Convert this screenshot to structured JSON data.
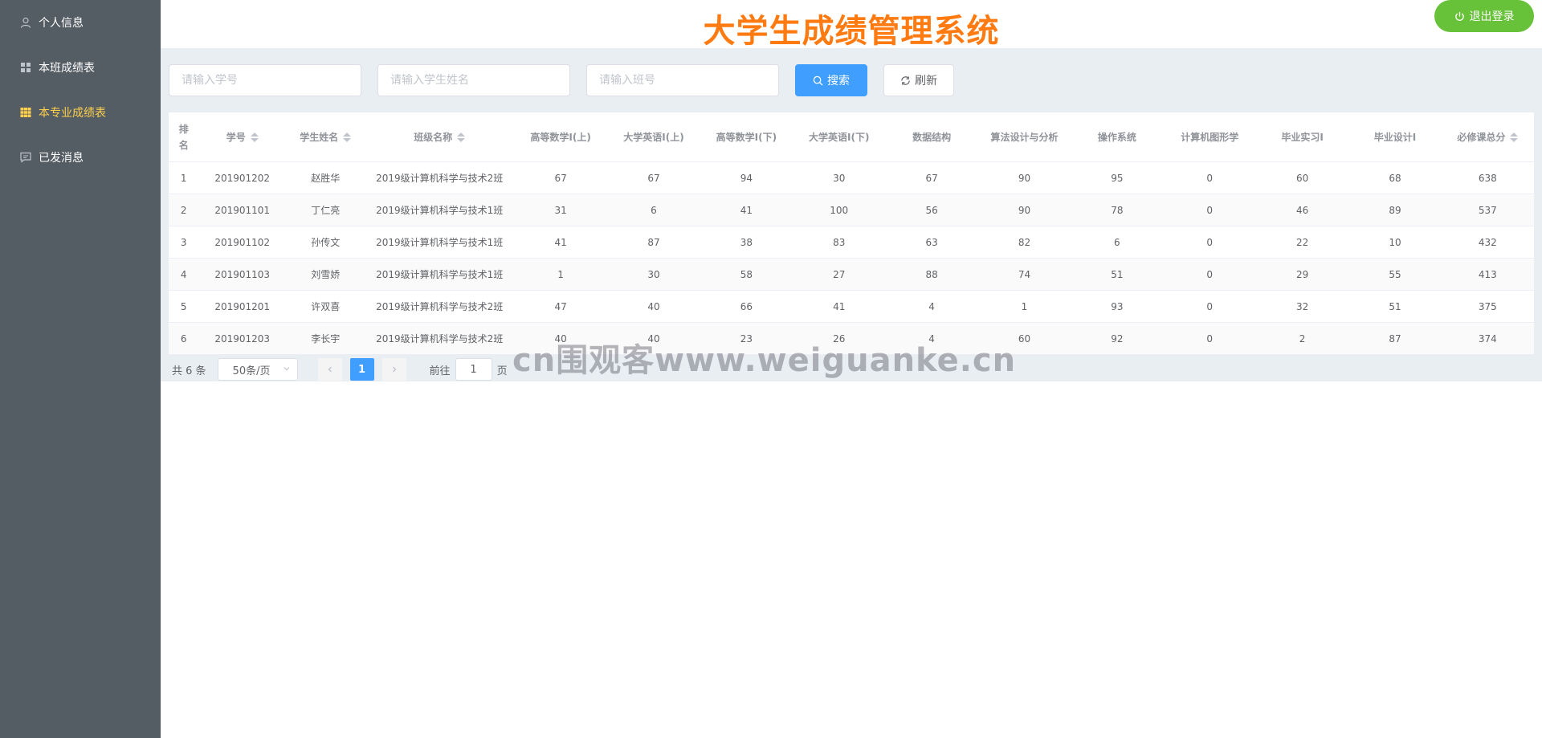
{
  "sidebar": {
    "items": [
      {
        "label": "个人信息",
        "icon": "user-icon"
      },
      {
        "label": "本班成绩表",
        "icon": "grid-icon"
      },
      {
        "label": "本专业成绩表",
        "icon": "table-icon"
      },
      {
        "label": "已发消息",
        "icon": "message-icon"
      }
    ],
    "active_index": 2,
    "colors": {
      "bg": "#545c64",
      "active": "#ffd04b"
    }
  },
  "header": {
    "title": "大学生成绩管理系统",
    "logout_label": "退出登录"
  },
  "search": {
    "student_id_placeholder": "请输入学号",
    "student_name_placeholder": "请输入学生姓名",
    "class_placeholder": "请输入班号",
    "search_label": "搜索",
    "refresh_label": "刷新"
  },
  "table": {
    "columns": [
      "排名",
      "学号",
      "学生姓名",
      "班级名称",
      "高等数学I(上)",
      "大学英语I(上)",
      "高等数学I(下)",
      "大学英语I(下)",
      "数据结构",
      "算法设计与分析",
      "操作系统",
      "计算机图形学",
      "毕业实习I",
      "毕业设计I",
      "必修课总分"
    ],
    "rows": [
      [
        "1",
        "201901202",
        "赵胜华",
        "2019级计算机科学与技术2班",
        "67",
        "67",
        "94",
        "30",
        "67",
        "90",
        "95",
        "0",
        "60",
        "68",
        "638"
      ],
      [
        "2",
        "201901101",
        "丁仁亮",
        "2019级计算机科学与技术1班",
        "31",
        "6",
        "41",
        "100",
        "56",
        "90",
        "78",
        "0",
        "46",
        "89",
        "537"
      ],
      [
        "3",
        "201901102",
        "孙传文",
        "2019级计算机科学与技术1班",
        "41",
        "87",
        "38",
        "83",
        "63",
        "82",
        "6",
        "0",
        "22",
        "10",
        "432"
      ],
      [
        "4",
        "201901103",
        "刘雪娇",
        "2019级计算机科学与技术1班",
        "1",
        "30",
        "58",
        "27",
        "88",
        "74",
        "51",
        "0",
        "29",
        "55",
        "413"
      ],
      [
        "5",
        "201901201",
        "许双喜",
        "2019级计算机科学与技术2班",
        "47",
        "40",
        "66",
        "41",
        "4",
        "1",
        "93",
        "0",
        "32",
        "51",
        "375"
      ],
      [
        "6",
        "201901203",
        "李长宇",
        "2019级计算机科学与技术2班",
        "40",
        "40",
        "23",
        "26",
        "4",
        "60",
        "92",
        "0",
        "2",
        "87",
        "374"
      ]
    ]
  },
  "pagination": {
    "total": "共 6 条",
    "page_size": "50条/页",
    "current_page": "1",
    "goto_prefix": "前往",
    "goto_value": "1",
    "goto_suffix": "页"
  },
  "watermark": "cn围观客www.weiguanke.cn",
  "colors": {
    "title": "#ff7b12",
    "primary": "#409eff",
    "logout": "#67c23a"
  }
}
